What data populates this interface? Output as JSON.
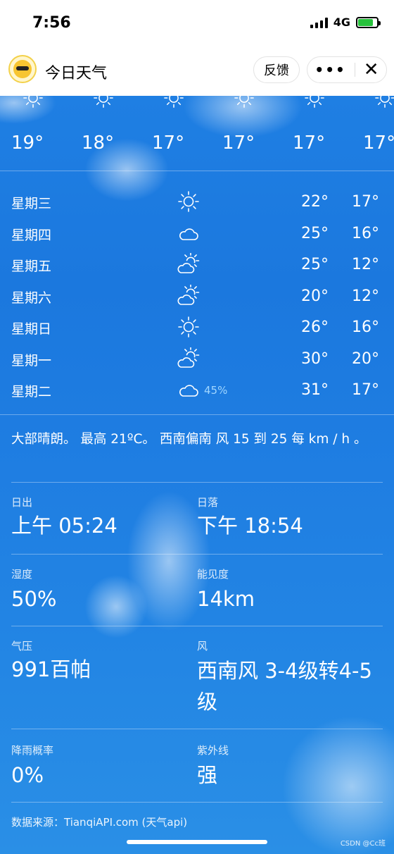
{
  "status": {
    "time": "7:56",
    "network": "4G"
  },
  "nav": {
    "title": "今日天气",
    "feedback": "反馈",
    "more": "•••",
    "close": "✕"
  },
  "hourly": [
    {
      "temp": "19°",
      "icon": "sun-icon"
    },
    {
      "temp": "18°",
      "icon": "sun-icon"
    },
    {
      "temp": "17°",
      "icon": "sun-icon"
    },
    {
      "temp": "17°",
      "icon": "sun-icon"
    },
    {
      "temp": "17°",
      "icon": "sun-icon"
    },
    {
      "temp": "17°",
      "icon": "sun-icon"
    }
  ],
  "daily": [
    {
      "day": "星期三",
      "icon": "sun-icon",
      "prob": "",
      "hi": "22°",
      "lo": "17°"
    },
    {
      "day": "星期四",
      "icon": "cloud-icon",
      "prob": "",
      "hi": "25°",
      "lo": "16°"
    },
    {
      "day": "星期五",
      "icon": "partly-cloudy-icon",
      "prob": "",
      "hi": "25°",
      "lo": "12°"
    },
    {
      "day": "星期六",
      "icon": "partly-cloudy-icon",
      "prob": "",
      "hi": "20°",
      "lo": "12°"
    },
    {
      "day": "星期日",
      "icon": "sun-icon",
      "prob": "",
      "hi": "26°",
      "lo": "16°"
    },
    {
      "day": "星期一",
      "icon": "partly-cloudy-icon",
      "prob": "",
      "hi": "30°",
      "lo": "20°"
    },
    {
      "day": "星期二",
      "icon": "cloud-icon",
      "prob": "45%",
      "hi": "31°",
      "lo": "17°"
    }
  ],
  "summary": "大部晴朗。 最高 21ºC。 西南偏南 风 15 到 25 每 km / h 。",
  "details": {
    "sunrise_label": "日出",
    "sunrise": "上午 05:24",
    "sunset_label": "日落",
    "sunset": "下午 18:54",
    "humidity_label": "湿度",
    "humidity": "50%",
    "visibility_label": "能见度",
    "visibility": "14km",
    "pressure_label": "气压",
    "pressure": "991百帕",
    "wind_label": "风",
    "wind": "西南风 3-4级转4-5级",
    "rain_label": "降雨概率",
    "rain": "0%",
    "uv_label": "紫外线",
    "uv": "强"
  },
  "source": "数据来源：TianqiAPI.com (天气api)",
  "watermark": "CSDN @Cc班"
}
